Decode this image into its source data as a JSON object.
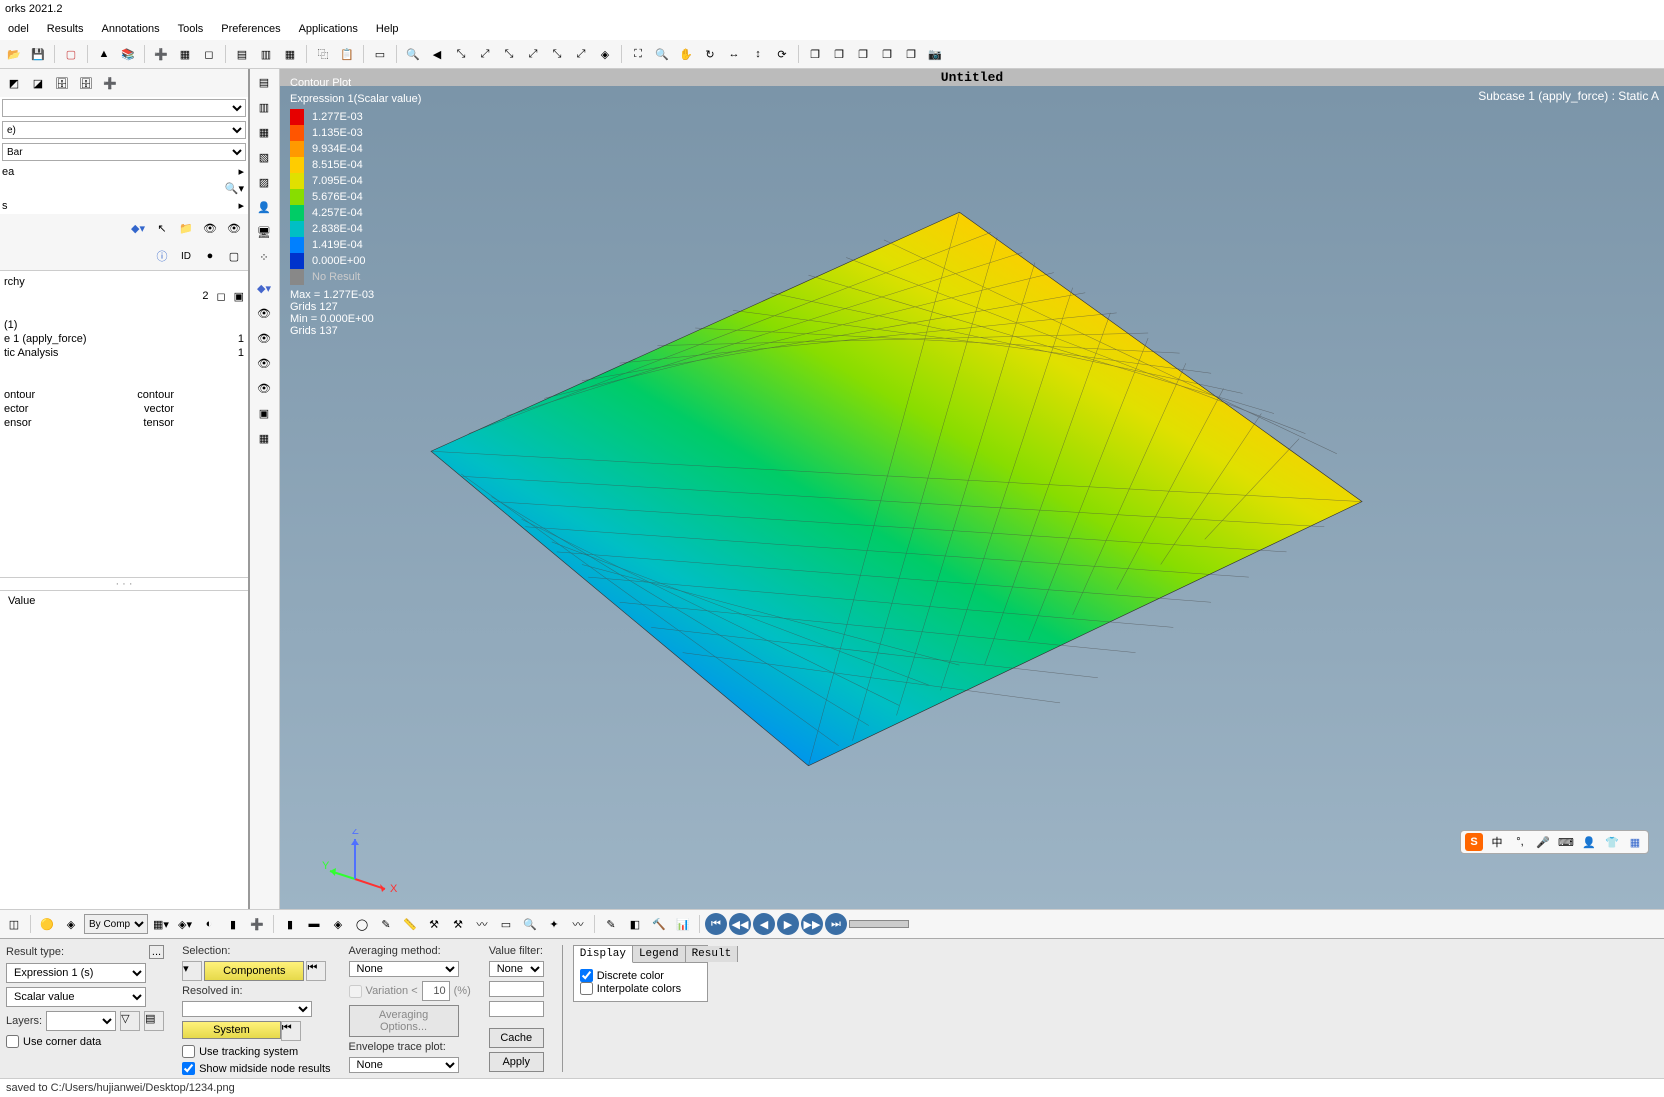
{
  "app": {
    "title": "orks 2021.2"
  },
  "menu": [
    "odel",
    "Results",
    "Annotations",
    "Tools",
    "Preferences",
    "Applications",
    "Help"
  ],
  "viewport": {
    "title": "Untitled",
    "subcase_label": "Subcase 1 (apply_force) : Static A",
    "plot_title": "Contour Plot",
    "plot_expr": "Expression 1(Scalar value)",
    "legend_levels": [
      {
        "color": "#e60000",
        "val": "1.277E-03"
      },
      {
        "color": "#ff5500",
        "val": "1.135E-03"
      },
      {
        "color": "#ff9900",
        "val": "9.934E-04"
      },
      {
        "color": "#ffcc00",
        "val": "8.515E-04"
      },
      {
        "color": "#e0e000",
        "val": "7.095E-04"
      },
      {
        "color": "#88dd00",
        "val": "5.676E-04"
      },
      {
        "color": "#00cc66",
        "val": "4.257E-04"
      },
      {
        "color": "#00bfc4",
        "val": "2.838E-04"
      },
      {
        "color": "#0080ff",
        "val": "1.419E-04"
      },
      {
        "color": "#0033cc",
        "val": "0.000E+00"
      }
    ],
    "no_result": "No Result",
    "max_label": "Max =  1.277E-03",
    "max_grids": "Grids 127",
    "min_label": "Min =  0.000E+00",
    "min_grids": "Grids 137"
  },
  "left_panel": {
    "dd1": "e)",
    "dd2": "Bar",
    "dd3": "ea",
    "dd4": "s",
    "hierarchy_label": "rchy",
    "count1": "2",
    "rows": [
      {
        "l": "(1)",
        "r": ""
      },
      {
        "l": "e 1 (apply_force)",
        "r": "1"
      },
      {
        "l": "tic Analysis",
        "r": "1"
      }
    ],
    "types": [
      {
        "l": "ontour",
        "r": "contour"
      },
      {
        "l": "ector",
        "r": "vector"
      },
      {
        "l": "ensor",
        "r": "tensor"
      }
    ],
    "value_hdr": "Value"
  },
  "bottom": {
    "result_type_lbl": "Result type:",
    "result_type": "Expression 1 (s)",
    "scalar": "Scalar value",
    "layers_lbl": "Layers:",
    "use_corner": "Use corner data",
    "selection_lbl": "Selection:",
    "components": "Components",
    "resolved_lbl": "Resolved in:",
    "system": "System",
    "track": "Use tracking system",
    "midside": "Show midside node results",
    "avg_lbl": "Averaging method:",
    "avg_val": "None",
    "variation": "Variation <",
    "variation_val": "10",
    "variation_pct": "(%)",
    "avg_opts": "Averaging Options...",
    "env_lbl": "Envelope trace plot:",
    "env_val": "None",
    "vfilter_lbl": "Value filter:",
    "vfilter_val": "None",
    "cache": "Cache",
    "apply": "Apply",
    "tab_display": "Display",
    "tab_legend": "Legend",
    "tab_result": "Result",
    "discrete": "Discrete color",
    "interpolate": "Interpolate colors"
  },
  "status": "saved to C:/Users/hujianwei/Desktop/1234.png",
  "bottom_tb": {
    "bycomp": "By Comp"
  },
  "ime": {
    "cn": "中"
  },
  "tree_tb": {
    "id": "ID"
  }
}
